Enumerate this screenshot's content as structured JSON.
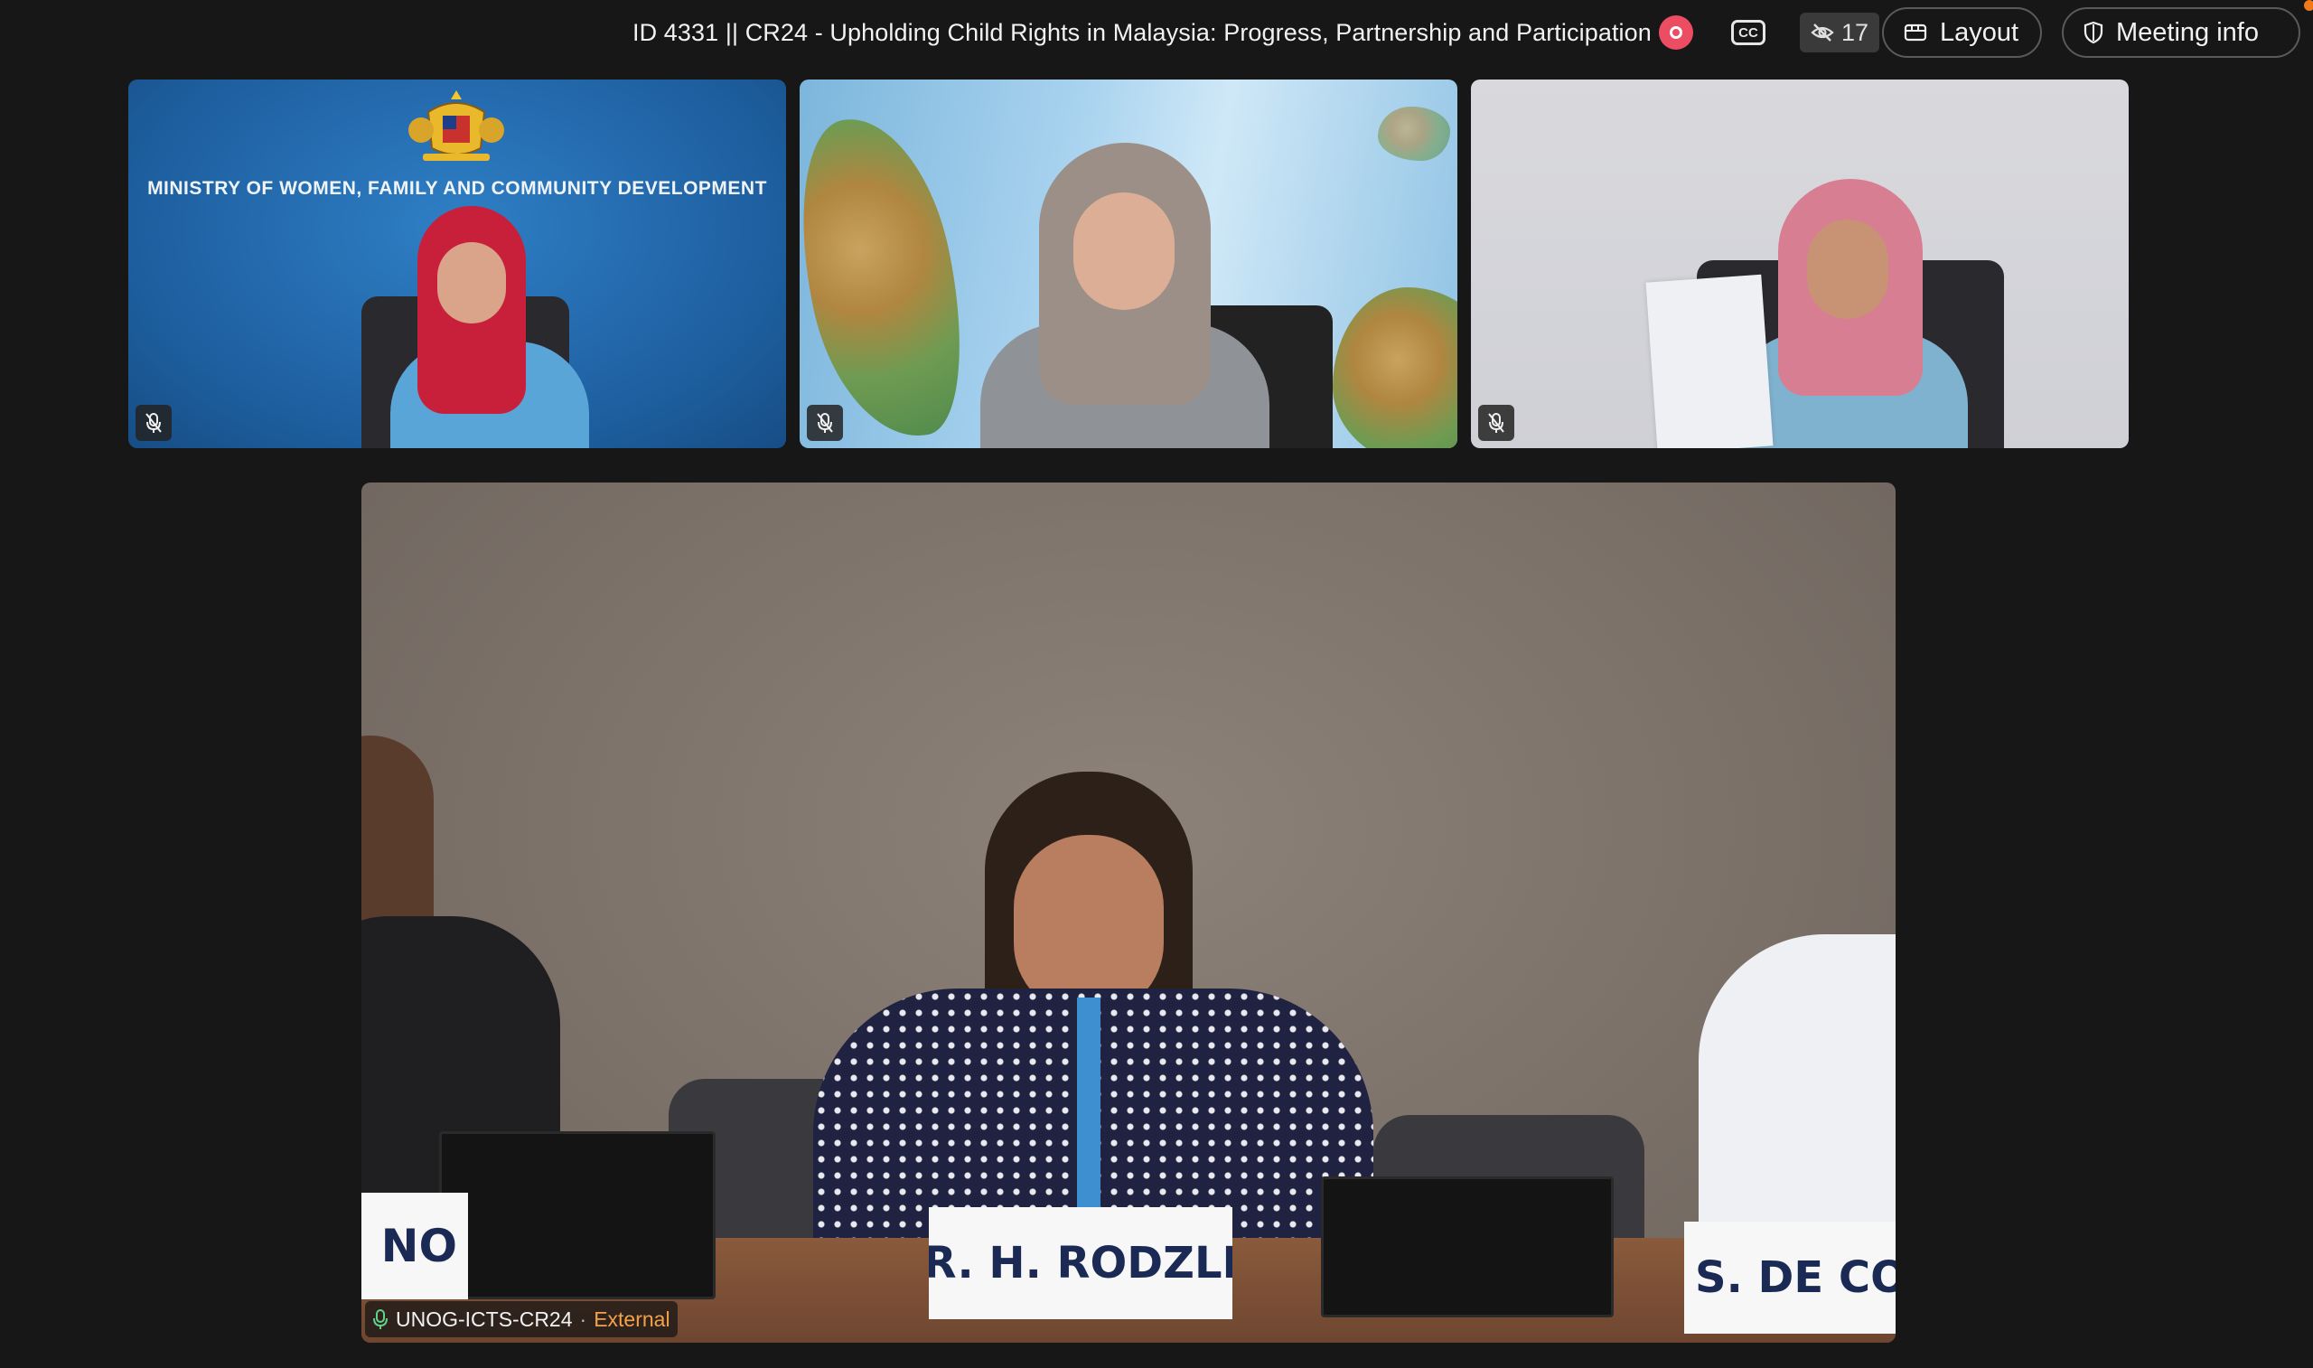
{
  "header": {
    "meeting_title": "ID 4331 || CR24 - Upholding Child Rights in Malaysia: Progress, Partnership and Participation",
    "captions_label": "CC",
    "viewer_count": "17",
    "layout_label": "Layout",
    "meeting_info_label": "Meeting info"
  },
  "tiles": [
    {
      "background_text": "MINISTRY OF WOMEN, FAMILY AND COMMUNITY DEVELOPMENT",
      "muted": true
    },
    {
      "muted": true
    },
    {
      "muted": true
    }
  ],
  "main_video": {
    "source_name": "UNOG-ICTS-CR24",
    "separator": "·",
    "source_type": "External",
    "namecards": {
      "left": "NO",
      "center": "R. H. RODZLI",
      "right": "S. DE CONI"
    }
  },
  "colors": {
    "background": "#171717",
    "record": "#ec4d62",
    "external": "#f5a14a"
  },
  "icons": [
    "record-icon",
    "closed-captions-icon",
    "hidden-eye-icon",
    "layout-icon",
    "shield-icon",
    "mic-muted-icon",
    "mic-active-icon"
  ]
}
